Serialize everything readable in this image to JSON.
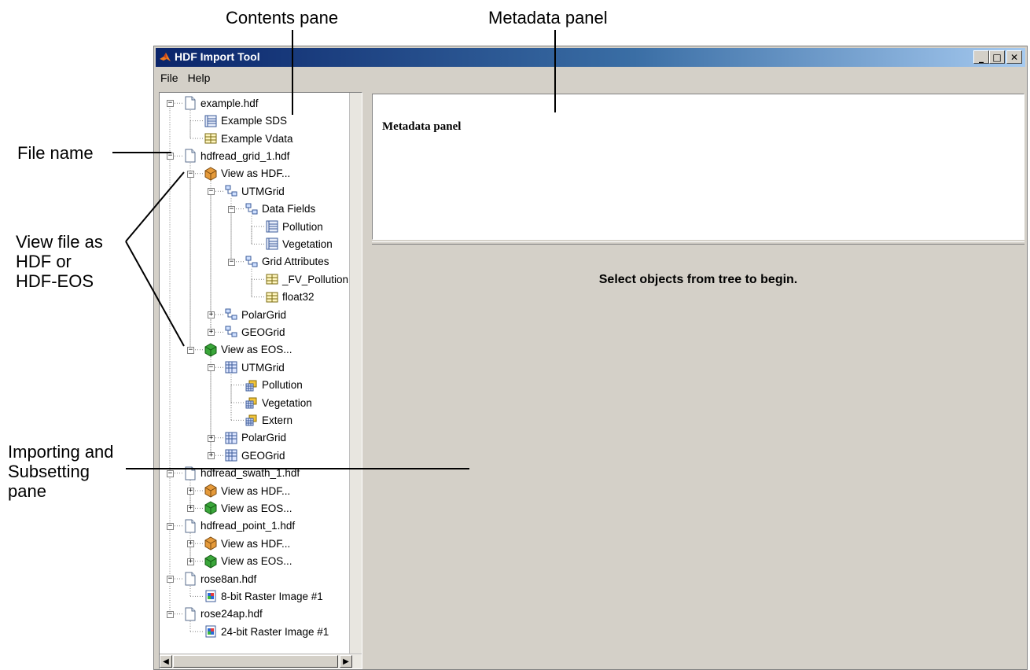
{
  "callouts": {
    "contents_pane": "Contents pane",
    "metadata_panel": "Metadata panel",
    "file_name": "File name",
    "view_file_as": [
      "View file as",
      "HDF or",
      "HDF-EOS"
    ],
    "importing": [
      "Importing and",
      "Subsetting",
      "pane"
    ]
  },
  "window": {
    "title": "HDF Import Tool",
    "minimize": "_",
    "maximize": "□",
    "close": "✕"
  },
  "menu": {
    "file": "File",
    "help": "Help"
  },
  "tree": [
    {
      "label": "example.hdf",
      "icon": "file-icon",
      "depth": 0,
      "expander": "-"
    },
    {
      "label": "Example SDS",
      "icon": "sds-icon",
      "depth": 1,
      "expander": ""
    },
    {
      "label": "Example Vdata",
      "icon": "vdata-icon",
      "depth": 1,
      "expander": ""
    },
    {
      "label": "hdfread_grid_1.hdf",
      "icon": "file-icon",
      "depth": 0,
      "expander": "-"
    },
    {
      "label": "View as HDF...",
      "icon": "hdf-cube-icon",
      "depth": 1,
      "expander": "-"
    },
    {
      "label": "UTMGrid",
      "icon": "vgroup-icon",
      "depth": 2,
      "expander": "-"
    },
    {
      "label": "Data Fields",
      "icon": "vgroup-icon",
      "depth": 3,
      "expander": "-"
    },
    {
      "label": "Pollution",
      "icon": "sds-icon",
      "depth": 4,
      "expander": ""
    },
    {
      "label": "Vegetation",
      "icon": "sds-icon",
      "depth": 4,
      "expander": ""
    },
    {
      "label": "Grid Attributes",
      "icon": "vgroup-icon",
      "depth": 3,
      "expander": "-"
    },
    {
      "label": "_FV_Pollution",
      "icon": "vdata-icon",
      "depth": 4,
      "expander": ""
    },
    {
      "label": "float32",
      "icon": "vdata-icon",
      "depth": 4,
      "expander": ""
    },
    {
      "label": "PolarGrid",
      "icon": "vgroup-icon",
      "depth": 2,
      "expander": "+"
    },
    {
      "label": "GEOGrid",
      "icon": "vgroup-icon",
      "depth": 2,
      "expander": "+"
    },
    {
      "label": "View as EOS...",
      "icon": "eos-cube-icon",
      "depth": 1,
      "expander": "-"
    },
    {
      "label": "UTMGrid",
      "icon": "grid-icon",
      "depth": 2,
      "expander": "-"
    },
    {
      "label": "Pollution",
      "icon": "grid-field-icon",
      "depth": 3,
      "expander": ""
    },
    {
      "label": "Vegetation",
      "icon": "grid-field-icon",
      "depth": 3,
      "expander": ""
    },
    {
      "label": "Extern",
      "icon": "grid-field-icon",
      "depth": 3,
      "expander": ""
    },
    {
      "label": "PolarGrid",
      "icon": "grid-icon",
      "depth": 2,
      "expander": "+"
    },
    {
      "label": "GEOGrid",
      "icon": "grid-icon",
      "depth": 2,
      "expander": "+"
    },
    {
      "label": "hdfread_swath_1.hdf",
      "icon": "file-icon",
      "depth": 0,
      "expander": "-"
    },
    {
      "label": "View as HDF...",
      "icon": "hdf-cube-icon",
      "depth": 1,
      "expander": "+"
    },
    {
      "label": "View as EOS...",
      "icon": "eos-cube-icon",
      "depth": 1,
      "expander": "+"
    },
    {
      "label": "hdfread_point_1.hdf",
      "icon": "file-icon",
      "depth": 0,
      "expander": "-"
    },
    {
      "label": "View as HDF...",
      "icon": "hdf-cube-icon",
      "depth": 1,
      "expander": "+"
    },
    {
      "label": "View as EOS...",
      "icon": "eos-cube-icon",
      "depth": 1,
      "expander": "+"
    },
    {
      "label": "rose8an.hdf",
      "icon": "file-icon",
      "depth": 0,
      "expander": "-"
    },
    {
      "label": "8-bit Raster Image #1",
      "icon": "raster-icon",
      "depth": 1,
      "expander": ""
    },
    {
      "label": "rose24ap.hdf",
      "icon": "file-icon",
      "depth": 0,
      "expander": "-"
    },
    {
      "label": "24-bit Raster Image #1",
      "icon": "raster-icon",
      "depth": 1,
      "expander": ""
    }
  ],
  "metadata": {
    "title": "Metadata panel"
  },
  "import_pane": {
    "message": "Select objects from tree to begin."
  },
  "colors": {
    "title_start": "#0a246a",
    "title_end": "#a6caf0",
    "chrome": "#d4d0c8"
  }
}
